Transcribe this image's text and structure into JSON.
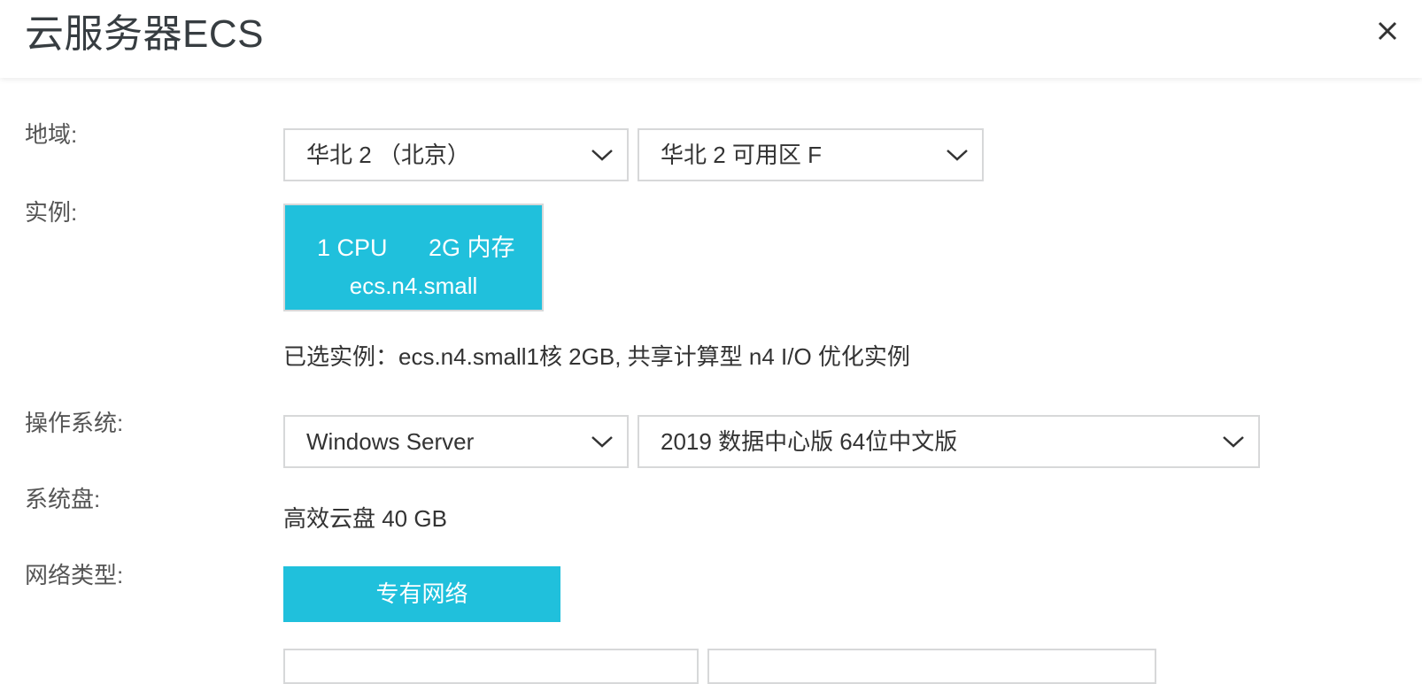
{
  "header": {
    "title": "云服务器ECS"
  },
  "region": {
    "label": "地域:",
    "region_value": "华北 2 （北京）",
    "zone_value": "华北 2 可用区 F"
  },
  "instance": {
    "label": "实例:",
    "cpu": "1 CPU",
    "memory": "2G 内存",
    "type_code": "ecs.n4.small",
    "selected_text": "已选实例：ecs.n4.small1核 2GB, 共享计算型 n4 I/O 优化实例"
  },
  "os": {
    "label": "操作系统:",
    "os_value": "Windows Server",
    "version_value": "2019 数据中心版 64位中文版"
  },
  "disk": {
    "label": "系统盘:",
    "value": "高效云盘 40 GB"
  },
  "network": {
    "label": "网络类型:",
    "button_label": "专有网络"
  },
  "colors": {
    "accent": "#20c0dc",
    "border": "#d7d8d9"
  }
}
